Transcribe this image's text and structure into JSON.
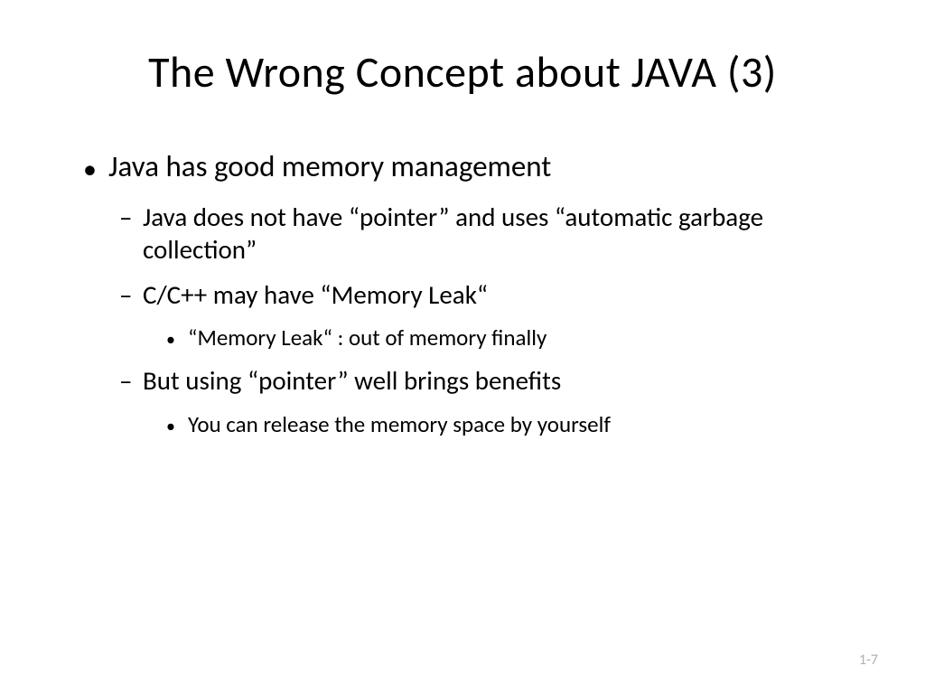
{
  "slide": {
    "title": "The Wrong Concept about JAVA (3)",
    "bullets": {
      "l1_1": "Java has good memory management",
      "l2_1": "Java does not have “pointer” and uses “automatic garbage collection”",
      "l2_2": "C/C++ may have “Memory Leak“",
      "l3_1": "“Memory Leak“ : out of memory finally",
      "l2_3": "But using “pointer” well brings benefits",
      "l3_2": "You can release the memory space by yourself"
    },
    "page_number": "1-7"
  }
}
